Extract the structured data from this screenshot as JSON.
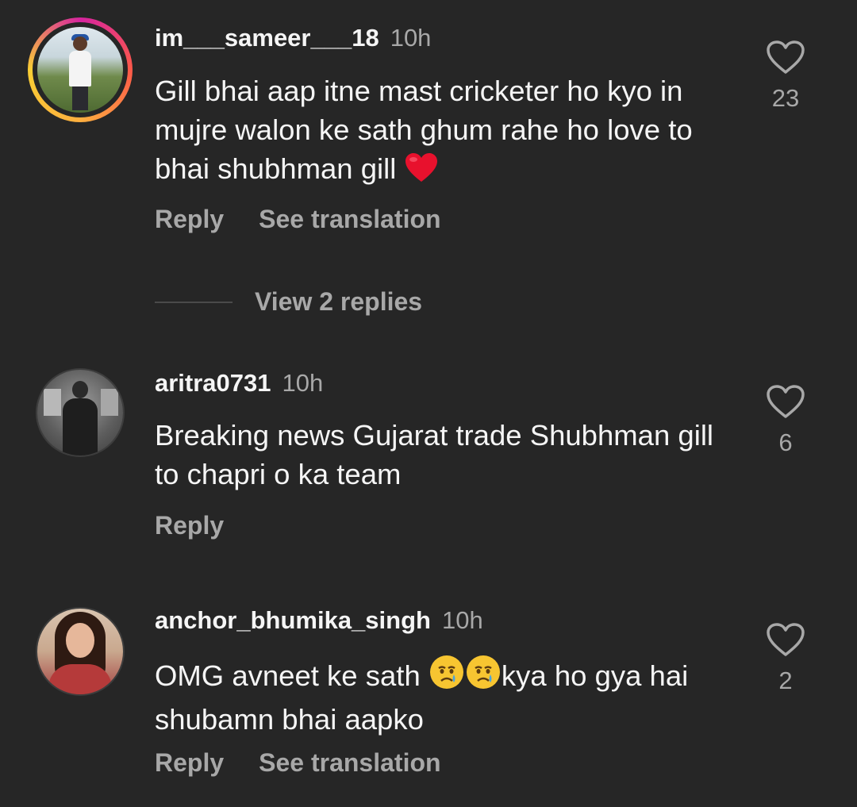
{
  "comments": [
    {
      "username": "im___sameer___18",
      "time": "10h",
      "text": "Gill bhai aap itne mast cricketer ho kyo in mujre walon ke sath ghum rahe ho love to bhai shubhman gill",
      "trailing_emoji": "red-heart",
      "likes": "23",
      "reply_label": "Reply",
      "translate_label": "See translation",
      "view_replies": "View 2 replies"
    },
    {
      "username": "aritra0731",
      "time": "10h",
      "text": "Breaking news Gujarat trade Shubhman gill to chapri o ka team",
      "likes": "6",
      "reply_label": "Reply"
    },
    {
      "username": "anchor_bhumika_singh",
      "time": "10h",
      "text_before": "OMG avneet ke sath ",
      "emojis": [
        "crying-face",
        "crying-face"
      ],
      "text_after": "kya ho gya hai shubamn bhai aapko",
      "likes": "2",
      "reply_label": "Reply",
      "translate_label": "See translation"
    }
  ],
  "colors": {
    "background": "#262626",
    "primary_text": "#f5f5f5",
    "secondary_text": "#a8a8a8",
    "story_ring": [
      "#d6249f",
      "#fd5949",
      "#fdaf3f"
    ]
  },
  "icons": {
    "like": "heart-outline-icon"
  }
}
